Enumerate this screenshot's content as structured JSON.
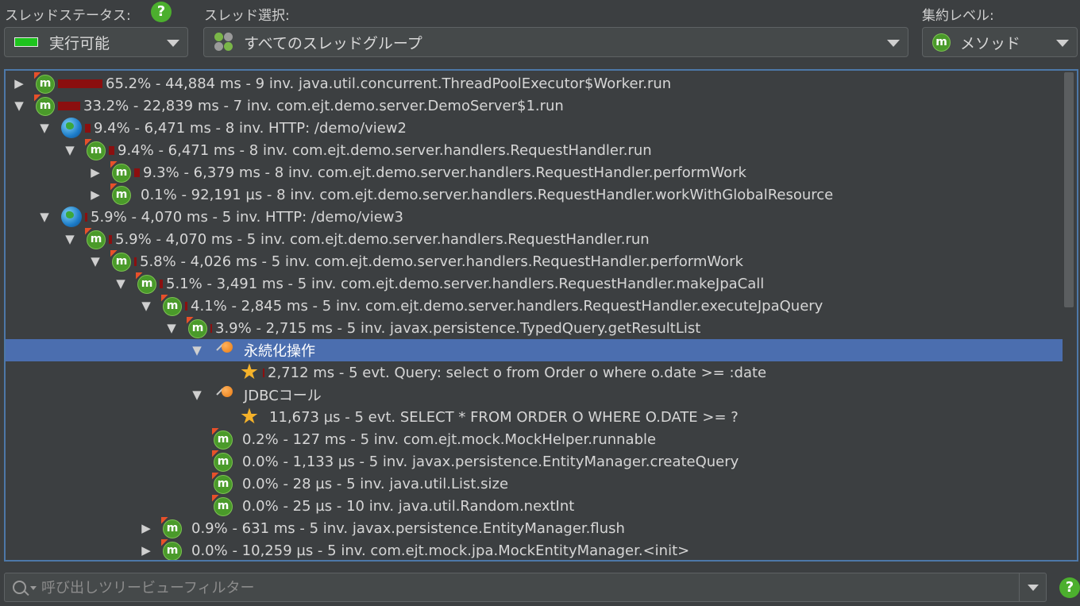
{
  "header": {
    "thread_status_label": "スレッドステータス:",
    "thread_status_value": "実行可能",
    "thread_select_label": "スレッド選択:",
    "thread_select_value": "すべてのスレッドグループ",
    "aggregation_label": "集約レベル:",
    "aggregation_value": "メソッド",
    "aggregation_badge": "m",
    "help": "?"
  },
  "tree": {
    "rows": [
      {
        "indent": 0,
        "toggle": "▶",
        "icon": "method",
        "bar": 56,
        "text": "65.2% - 44,884 ms - 9 inv. java.util.concurrent.ThreadPoolExecutor$Worker.run"
      },
      {
        "indent": 0,
        "toggle": "▼",
        "icon": "method",
        "bar": 28,
        "text": "33.2% - 22,839 ms - 7 inv. com.ejt.demo.server.DemoServer$1.run"
      },
      {
        "indent": 1,
        "toggle": "▼",
        "icon": "globe",
        "bar": 7,
        "text": "9.4% - 6,471 ms - 8 inv. HTTP: /demo/view2"
      },
      {
        "indent": 2,
        "toggle": "▼",
        "icon": "method",
        "bar": 7,
        "text": "9.4% - 6,471 ms - 8 inv. com.ejt.demo.server.handlers.RequestHandler.run"
      },
      {
        "indent": 3,
        "toggle": "▶",
        "icon": "method",
        "bar": 7,
        "text": "9.3% - 6,379 ms - 8 inv. com.ejt.demo.server.handlers.RequestHandler.performWork"
      },
      {
        "indent": 3,
        "toggle": "▶",
        "icon": "method",
        "bar": 0,
        "text": "0.1% - 92,191 µs - 8 inv. com.ejt.demo.server.handlers.RequestHandler.workWithGlobalResource"
      },
      {
        "indent": 1,
        "toggle": "▼",
        "icon": "globe",
        "bar": 3,
        "text": "5.9% - 4,070 ms - 5 inv. HTTP: /demo/view3"
      },
      {
        "indent": 2,
        "toggle": "▼",
        "icon": "method",
        "bar": 4,
        "text": "5.9% - 4,070 ms - 5 inv. com.ejt.demo.server.handlers.RequestHandler.run"
      },
      {
        "indent": 3,
        "toggle": "▼",
        "icon": "method",
        "bar": 3,
        "text": "5.8% - 4,026 ms - 5 inv. com.ejt.demo.server.handlers.RequestHandler.performWork"
      },
      {
        "indent": 4,
        "toggle": "▼",
        "icon": "method",
        "bar": 4,
        "text": "5.1% - 3,491 ms - 5 inv. com.ejt.demo.server.handlers.RequestHandler.makeJpaCall"
      },
      {
        "indent": 5,
        "toggle": "▼",
        "icon": "method",
        "bar": 3,
        "text": "4.1% - 2,845 ms - 5 inv. com.ejt.demo.server.handlers.RequestHandler.executeJpaQuery"
      },
      {
        "indent": 6,
        "toggle": "▼",
        "icon": "method",
        "bar": 2,
        "text": "3.9% - 2,715 ms - 5 inv. javax.persistence.TypedQuery.getResultList"
      },
      {
        "indent": 7,
        "toggle": "▼",
        "icon": "pin",
        "bar": 0,
        "text": "永続化操作",
        "selected": true
      },
      {
        "indent": 8,
        "toggle": "",
        "icon": "star",
        "bar": 2,
        "text": "2,712 ms - 5 evt. Query: select o from Order o where o.date >= :date"
      },
      {
        "indent": 7,
        "toggle": "▼",
        "icon": "pin",
        "bar": 0,
        "text": "JDBCコール"
      },
      {
        "indent": 8,
        "toggle": "",
        "icon": "star",
        "bar": 0,
        "text": "11,673 µs - 5 evt. SELECT * FROM ORDER O WHERE O.DATE >= ?"
      },
      {
        "indent": 7,
        "toggle": "",
        "icon": "method",
        "bar": 0,
        "text": "0.2% - 127 ms - 5 inv. com.ejt.mock.MockHelper.runnable"
      },
      {
        "indent": 7,
        "toggle": "",
        "icon": "method",
        "bar": 0,
        "text": "0.0% - 1,133 µs - 5 inv. javax.persistence.EntityManager.createQuery"
      },
      {
        "indent": 7,
        "toggle": "",
        "icon": "method",
        "bar": 0,
        "text": "0.0% - 28 µs - 5 inv. java.util.List.size"
      },
      {
        "indent": 7,
        "toggle": "",
        "icon": "method",
        "bar": 0,
        "text": "0.0% - 25 µs - 10 inv. java.util.Random.nextInt"
      },
      {
        "indent": 5,
        "toggle": "▶",
        "icon": "method",
        "bar": 0,
        "text": "0.9% - 631 ms - 5 inv. javax.persistence.EntityManager.flush"
      },
      {
        "indent": 5,
        "toggle": "▶",
        "icon": "method",
        "bar": 0,
        "text": "0.0% - 10,259 µs - 5 inv. com.ejt.mock.jpa.MockEntityManager.<init>"
      }
    ]
  },
  "filter": {
    "placeholder": "呼び出しツリービューフィルター",
    "help": "?"
  },
  "colors": {
    "accent": "#4b6eaf",
    "bar": "#8b0f0f",
    "status_green": "#1ec41e"
  }
}
